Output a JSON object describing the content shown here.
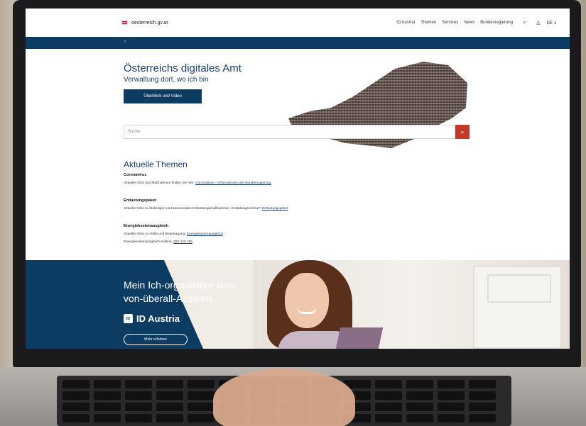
{
  "header": {
    "logo_text": "oesterreich.gv.at",
    "nav": [
      "ID Austria",
      "Themen",
      "Services",
      "News",
      "Bundesregierung"
    ],
    "lang": "DE ∨"
  },
  "breadcrumb": "⌂",
  "hero": {
    "title": "Österreichs digitales Amt",
    "subtitle": "Verwaltung dort, wo ich bin",
    "button": "Überblick und Video"
  },
  "search": {
    "placeholder": "Suche"
  },
  "themes": {
    "heading": "Aktuelle Themen",
    "items": [
      {
        "title": "Coronavirus",
        "text": "Aktuelle Infos und Maßnahmen finden Sie hier: ",
        "link": "Coronavirus – Informationen der Bundesregierung"
      },
      {
        "title": "Entlastungspaket",
        "text": "Aktuelle Infos zu bisherigen und kommenden Entlastungsmaßnahmen, Entladungsrechner: ",
        "link": "Entlastungspaket"
      },
      {
        "title": "Energiekostenausgleich",
        "text": "Aktuelle Infos zu Höhe und Beantragung: ",
        "link": "Energiekostenausgleich",
        "text2": "Energiekostenausgleich-Hotline: ",
        "link2": "050 233 766"
      }
    ]
  },
  "promo": {
    "title": "Mein Ich-organisiere-das-von-überall-Ausweis",
    "brand": "ID Austria",
    "badge": "ID",
    "button": "Mehr erfahren"
  },
  "colors": {
    "primary": "#0d3c63",
    "accent": "#c0392b"
  },
  "icons": {
    "search": "search-icon",
    "user": "user-icon",
    "flag": "austria-flag-icon"
  }
}
